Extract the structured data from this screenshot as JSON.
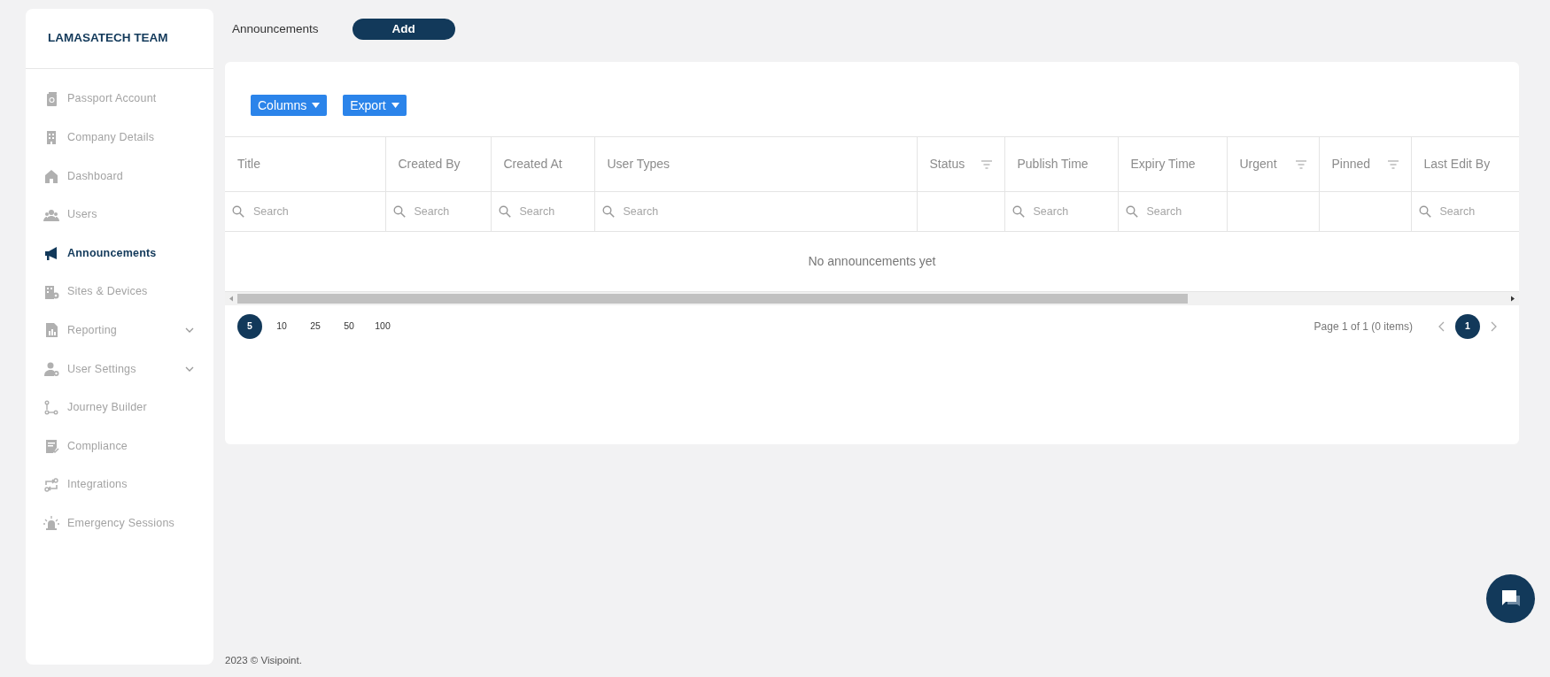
{
  "sidebar": {
    "team": "LAMASATECH TEAM",
    "items": [
      {
        "label": "Passport Account",
        "selected": false,
        "has_submenu": false
      },
      {
        "label": "Company Details",
        "selected": false,
        "has_submenu": false
      },
      {
        "label": "Dashboard",
        "selected": false,
        "has_submenu": false
      },
      {
        "label": "Users",
        "selected": false,
        "has_submenu": false
      },
      {
        "label": "Announcements",
        "selected": true,
        "has_submenu": false
      },
      {
        "label": "Sites & Devices",
        "selected": false,
        "has_submenu": false
      },
      {
        "label": "Reporting",
        "selected": false,
        "has_submenu": true
      },
      {
        "label": "User Settings",
        "selected": false,
        "has_submenu": true
      },
      {
        "label": "Journey Builder",
        "selected": false,
        "has_submenu": false
      },
      {
        "label": "Compliance",
        "selected": false,
        "has_submenu": false
      },
      {
        "label": "Integrations",
        "selected": false,
        "has_submenu": false
      },
      {
        "label": "Emergency Sessions",
        "selected": false,
        "has_submenu": false
      }
    ]
  },
  "header": {
    "title": "Announcements",
    "add_button": "Add"
  },
  "toolbar": {
    "buttons": [
      "Columns",
      "Export"
    ]
  },
  "table": {
    "columns": [
      {
        "label": "Title",
        "has_filter_menu": false,
        "placeholder": "Search"
      },
      {
        "label": "Created By",
        "has_filter_menu": false,
        "placeholder": "Search"
      },
      {
        "label": "Created At",
        "has_filter_menu": false,
        "placeholder": "Search"
      },
      {
        "label": "User Types",
        "has_filter_menu": false,
        "placeholder": "Search"
      },
      {
        "label": "Status",
        "has_filter_menu": true
      },
      {
        "label": "Publish Time",
        "has_filter_menu": false,
        "placeholder": "Search"
      },
      {
        "label": "Expiry Time",
        "has_filter_menu": false,
        "placeholder": "Search"
      },
      {
        "label": "Urgent",
        "has_filter_menu": true
      },
      {
        "label": "Pinned",
        "has_filter_menu": true
      },
      {
        "label": "Last Edit By",
        "has_filter_menu": false,
        "placeholder": "Search"
      }
    ],
    "empty_message": "No announcements yet"
  },
  "pagination": {
    "page_sizes": [
      {
        "label": "5",
        "selected": true
      },
      {
        "label": "10",
        "selected": false
      },
      {
        "label": "25",
        "selected": false
      },
      {
        "label": "50",
        "selected": false
      },
      {
        "label": "100",
        "selected": false
      }
    ],
    "summary": "Page 1 of 1 (0 items)",
    "pages": [
      {
        "label": "1",
        "selected": true
      }
    ]
  },
  "footer": "2023 © Visipoint."
}
